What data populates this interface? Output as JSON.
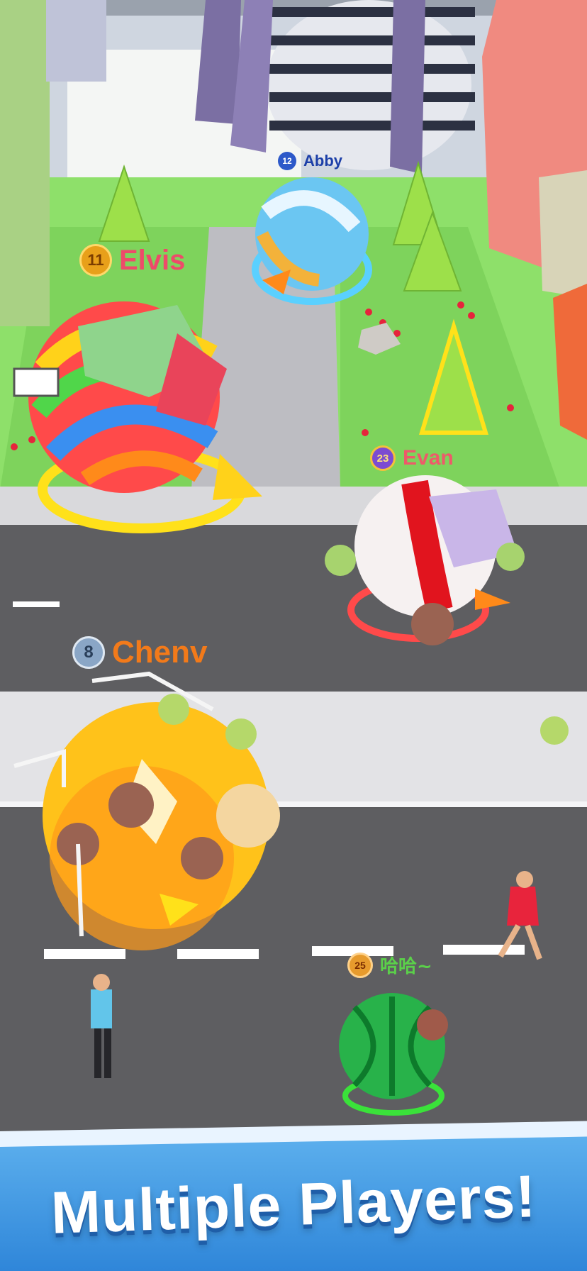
{
  "players": [
    {
      "id": "abby",
      "name": "Abby",
      "level": "12",
      "color": "#1c3fa8",
      "badge_color": "#2d59c9"
    },
    {
      "id": "elvis",
      "name": "Elvis",
      "level": "11",
      "color": "#ee4a6a",
      "badge_color": "#e8a01a"
    },
    {
      "id": "evan",
      "name": "Evan",
      "level": "23",
      "color": "#ee5a6a",
      "badge_color": "#7c4bd1"
    },
    {
      "id": "chenv",
      "name": "Chenv",
      "level": "8",
      "color": "#f27a1a",
      "badge_color": "#8aa6c6"
    },
    {
      "id": "haha",
      "name": "哈哈~",
      "level": "25",
      "color": "#5bd04a",
      "badge_color": "#e79b2d"
    }
  ],
  "banner": {
    "title": "Multiple Players!"
  },
  "colors": {
    "grass": "#8ee06a",
    "road": "#5e5e61",
    "sidewalk": "#d9d9dc",
    "banner": "#3d95e0"
  },
  "icons": [
    "rank-medal-icon",
    "ball-icon",
    "tree-icon",
    "building-icon",
    "pedestrian-icon",
    "car-icon"
  ]
}
